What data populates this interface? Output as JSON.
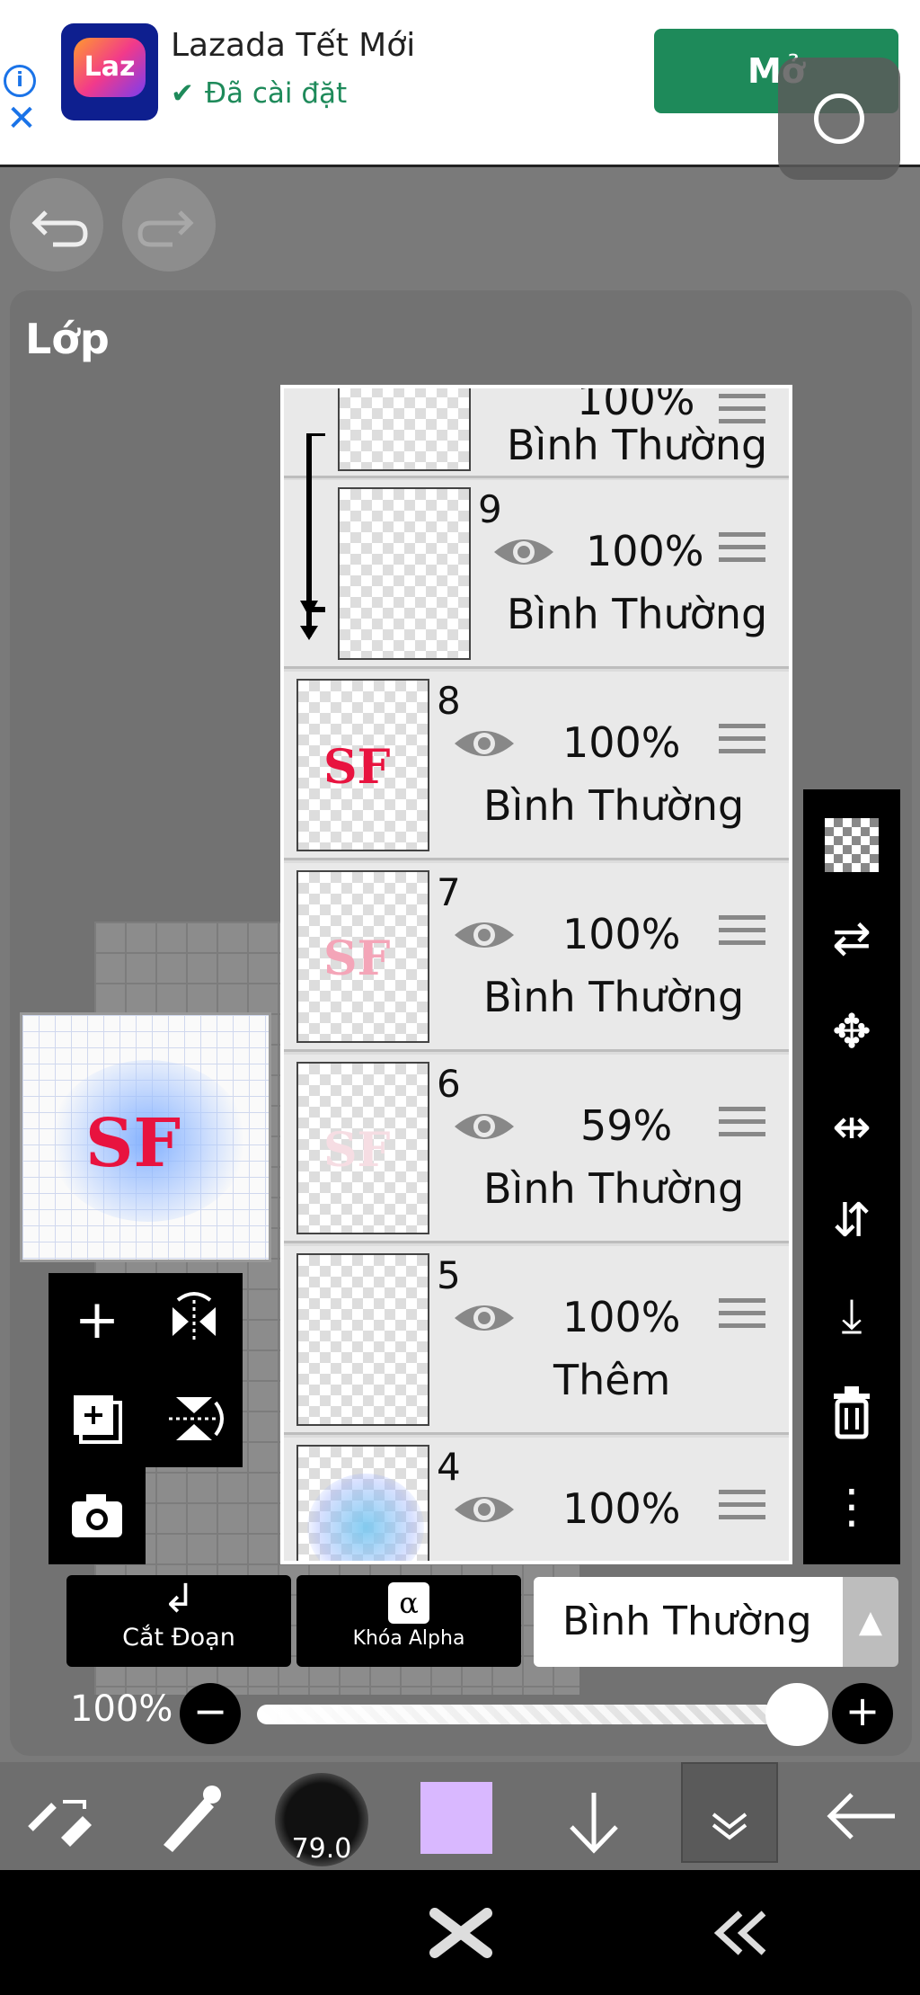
{
  "ad": {
    "info_icon": "info-icon",
    "close_icon": "close-icon",
    "logo_text": "Laz",
    "title": "Lazada Tết Mới",
    "subtitle": "Đã cài đặt",
    "open_label": "Mở"
  },
  "panel": {
    "title": "Lớp"
  },
  "layers": [
    {
      "num": "",
      "opacity": "100%",
      "mode": "Bình Thường"
    },
    {
      "num": "9",
      "opacity": "100%",
      "mode": "Bình Thường"
    },
    {
      "num": "8",
      "opacity": "100%",
      "mode": "Bình Thường"
    },
    {
      "num": "7",
      "opacity": "100%",
      "mode": "Bình Thường"
    },
    {
      "num": "6",
      "opacity": "59%",
      "mode": "Bình Thường"
    },
    {
      "num": "5",
      "opacity": "100%",
      "mode": "Thêm"
    },
    {
      "num": "4",
      "opacity": "100%",
      "mode": ""
    }
  ],
  "thumb_text": "SF",
  "bottom": {
    "clip_label": "Cắt Đoạn",
    "alpha_label": "Khóa Alpha",
    "alpha_symbol": "α",
    "blend_mode": "Bình Thường",
    "opacity": "100%"
  },
  "toolbar": {
    "brush_size": "79.0",
    "color": "#d9b8ff"
  }
}
